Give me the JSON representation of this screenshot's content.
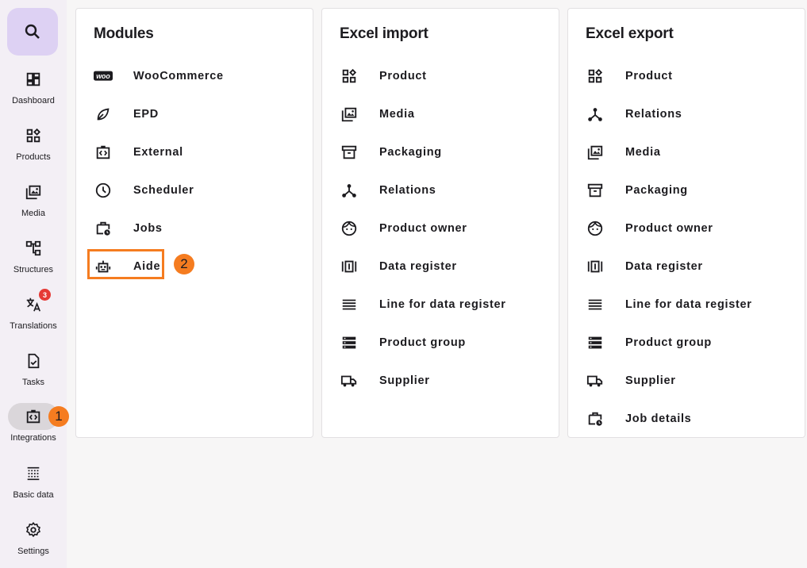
{
  "sidebar": {
    "items": [
      {
        "label": "Dashboard",
        "icon": "dashboard-icon"
      },
      {
        "label": "Products",
        "icon": "products-icon"
      },
      {
        "label": "Media",
        "icon": "media-icon"
      },
      {
        "label": "Structures",
        "icon": "structures-icon"
      },
      {
        "label": "Translations",
        "icon": "translate-icon",
        "badge": "3"
      },
      {
        "label": "Tasks",
        "icon": "tasks-icon"
      },
      {
        "label": "Integrations",
        "icon": "integrations-icon",
        "active": true
      },
      {
        "label": "Basic data",
        "icon": "basic-data-icon"
      },
      {
        "label": "Settings",
        "icon": "gear-icon"
      }
    ]
  },
  "modules": {
    "title": "Modules",
    "items": [
      {
        "label": "WooCommerce",
        "icon": "woo-logo-icon"
      },
      {
        "label": "EPD",
        "icon": "leaf-icon"
      },
      {
        "label": "External",
        "icon": "integration-code-icon"
      },
      {
        "label": "Scheduler",
        "icon": "clock-icon"
      },
      {
        "label": "Jobs",
        "icon": "work-history-icon"
      },
      {
        "label": "Aide",
        "icon": "robot-icon"
      }
    ]
  },
  "excel_import": {
    "title": "Excel import",
    "items": [
      {
        "label": "Product",
        "icon": "category-icon"
      },
      {
        "label": "Media",
        "icon": "media-icon"
      },
      {
        "label": "Packaging",
        "icon": "archive-icon"
      },
      {
        "label": "Relations",
        "icon": "relations-icon"
      },
      {
        "label": "Product owner",
        "icon": "face-icon"
      },
      {
        "label": "Data register",
        "icon": "data-register-icon"
      },
      {
        "label": "Line for data register",
        "icon": "lines-icon"
      },
      {
        "label": "Product group",
        "icon": "storage-icon"
      },
      {
        "label": "Supplier",
        "icon": "truck-icon"
      }
    ]
  },
  "excel_export": {
    "title": "Excel export",
    "items": [
      {
        "label": "Product",
        "icon": "category-icon"
      },
      {
        "label": "Relations",
        "icon": "relations-icon"
      },
      {
        "label": "Media",
        "icon": "media-icon"
      },
      {
        "label": "Packaging",
        "icon": "archive-icon"
      },
      {
        "label": "Product owner",
        "icon": "face-icon"
      },
      {
        "label": "Data register",
        "icon": "data-register-icon"
      },
      {
        "label": "Line for data register",
        "icon": "lines-icon"
      },
      {
        "label": "Product group",
        "icon": "storage-icon"
      },
      {
        "label": "Supplier",
        "icon": "truck-icon"
      },
      {
        "label": "Job details",
        "icon": "work-history-icon"
      }
    ]
  },
  "annotations": {
    "marker_1": "1",
    "marker_2": "2"
  },
  "colors": {
    "accent": "#f57c20",
    "search_bg": "#ddd1f3",
    "badge": "#e53935"
  }
}
